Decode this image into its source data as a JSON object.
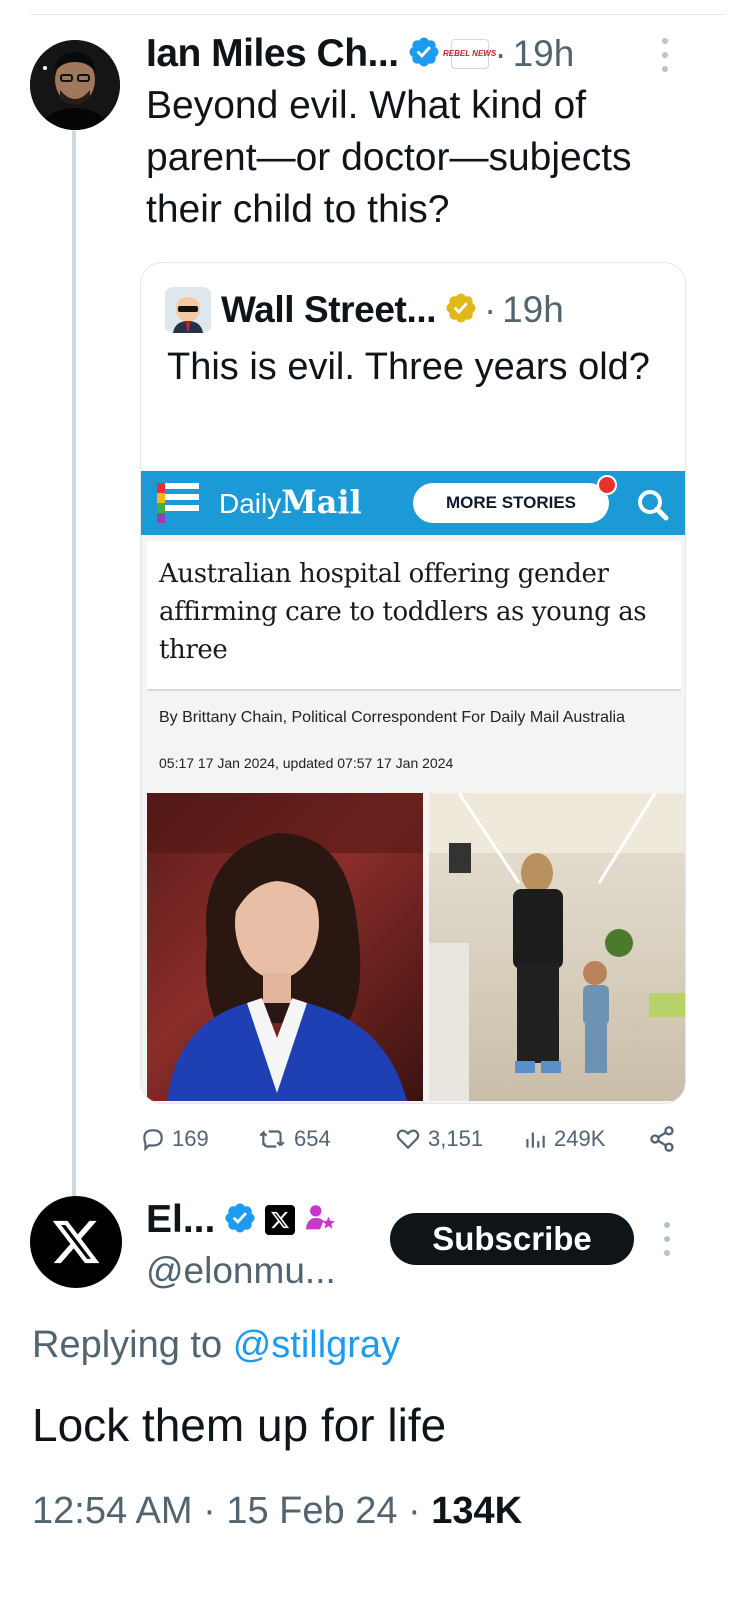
{
  "post": {
    "author_name": "Ian Miles Ch...",
    "separator": "·",
    "time": "19h",
    "text": "Beyond evil. What kind of parent—or doctor—subjects their child to this?",
    "affiliate_badge_text": "REBEL NEWS"
  },
  "quoted": {
    "author_name": "Wall Street...",
    "separator": "·",
    "time": "19h",
    "text": "This is evil.  Three years old?",
    "article": {
      "site_prefix": "Daily",
      "site_name": "Mail",
      "more_stories_label": "MORE STORIES",
      "headline": "Australian hospital offering gender affirming care to toddlers as young as three",
      "byline": "By Brittany Chain, Political Correspondent For Daily Mail Australia",
      "dateline": "05:17 17 Jan 2024, updated 07:57 17 Jan 2024"
    }
  },
  "actions": {
    "replies": "169",
    "reposts": "654",
    "likes": "3,151",
    "views": "249K"
  },
  "reply": {
    "author_name": "El...",
    "handle": "@elonmu...",
    "subscribe_label": "Subscribe",
    "replying_prefix": "Replying to",
    "replying_to": "@stillgray",
    "text": "Lock them up for life",
    "time": "12:54 AM",
    "separator1": "·",
    "date": "15 Feb 24",
    "separator2": "·",
    "views": "134K"
  },
  "colors": {
    "verified_blue": "#1d9bf0",
    "verified_gold": "#e2b719",
    "daily_mail_blue": "#1b9ad6",
    "muted_text": "#536471"
  }
}
